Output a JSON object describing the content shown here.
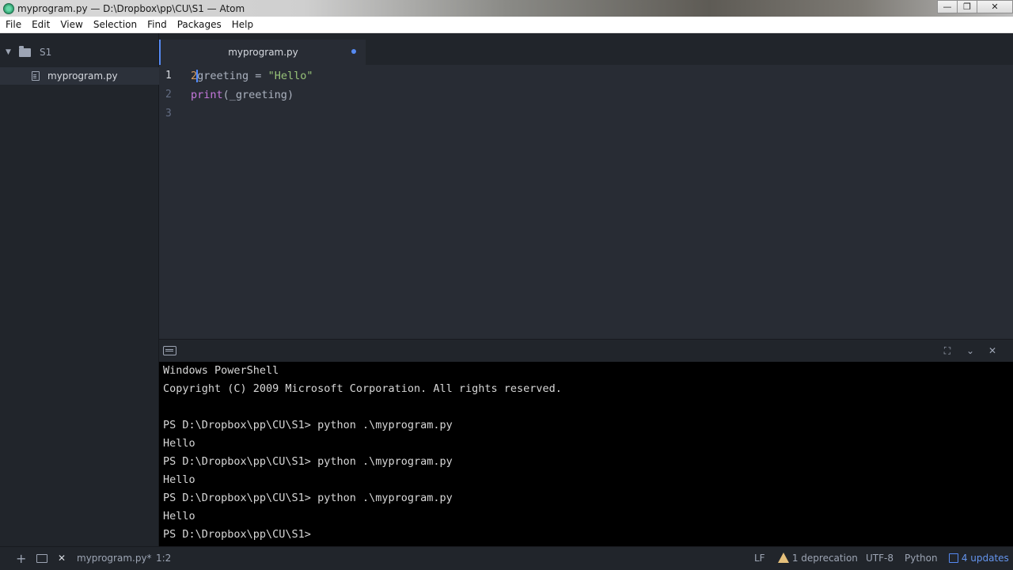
{
  "window": {
    "title": "myprogram.py — D:\\Dropbox\\pp\\CU\\S1 — Atom",
    "minimize": "—",
    "maximize": "❐",
    "close": "✕"
  },
  "menu": [
    "File",
    "Edit",
    "View",
    "Selection",
    "Find",
    "Packages",
    "Help"
  ],
  "tree": {
    "root": "S1",
    "files": [
      "myprogram.py"
    ]
  },
  "tab": {
    "label": "myprogram.py",
    "modified": true
  },
  "editor": {
    "line_numbers": [
      "1",
      "2",
      "3"
    ],
    "lines": [
      {
        "num": "2",
        "var": "greeting",
        "op": " = ",
        "str": "\"Hello\""
      },
      {
        "fn": "print",
        "open": "(",
        "arg": "_greeting",
        "close": ")"
      },
      {}
    ]
  },
  "terminal": {
    "lines": [
      "Windows PowerShell",
      "Copyright (C) 2009 Microsoft Corporation. All rights reserved.",
      "",
      "PS D:\\Dropbox\\pp\\CU\\S1> python .\\myprogram.py",
      "Hello",
      "PS D:\\Dropbox\\pp\\CU\\S1> python .\\myprogram.py",
      "Hello",
      "PS D:\\Dropbox\\pp\\CU\\S1> python .\\myprogram.py",
      "Hello",
      "PS D:\\Dropbox\\pp\\CU\\S1>"
    ]
  },
  "status": {
    "add": "+",
    "terminal_icon": "terminal-icon",
    "close": "✕",
    "file": "myprogram.py*",
    "cursor_pos": "1:2",
    "line_ending": "LF",
    "deprecation": "1 deprecation",
    "encoding": "UTF-8",
    "grammar": "Python",
    "updates": "4 updates"
  }
}
